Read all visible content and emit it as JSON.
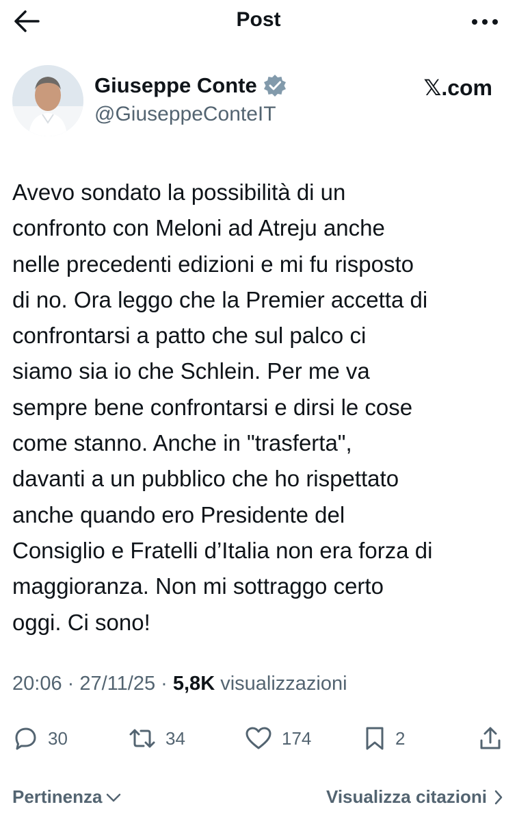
{
  "header": {
    "title": "Post",
    "back_icon": "arrow-left-icon",
    "more_icon": "more-horizontal-icon"
  },
  "author": {
    "display_name": "Giuseppe Conte",
    "handle": "@GiuseppeConteIT",
    "verified_icon": "verified-badge-icon",
    "source": "𝕏.com"
  },
  "tweet": {
    "text": "Avevo sondato la possibilità di un\nconfronto con Meloni ad Atreju anche\nnelle precedenti edizioni e mi fu risposto\ndi no. Ora leggo che la Premier accetta di\nconfrontarsi a patto che sul palco ci\nsiamo sia io che Schlein. Per me va\nsempre bene confrontarsi e dirsi le cose\ncome stanno. Anche in \"trasferta\",\ndavanti a un pubblico che ho rispettato\nanche quando ero Presidente del\nConsiglio e Fratelli d’Italia non era forza di\nmaggioranza. Non mi sottraggo certo\noggi. Ci sono!"
  },
  "meta": {
    "time": "20:06",
    "sep1": " · ",
    "date": "27/11/25",
    "sep2": " · ",
    "views_count": "5,8K",
    "views_label": "visualizzazioni"
  },
  "actions": {
    "replies": "30",
    "reposts": "34",
    "likes": "174",
    "bookmarks": "2"
  },
  "footer": {
    "sort_label": "Pertinenza",
    "quotes_label": "Visualizza citazioni"
  },
  "colors": {
    "text": "#0f1419",
    "secondary": "#536471",
    "verified": "#829aab"
  }
}
